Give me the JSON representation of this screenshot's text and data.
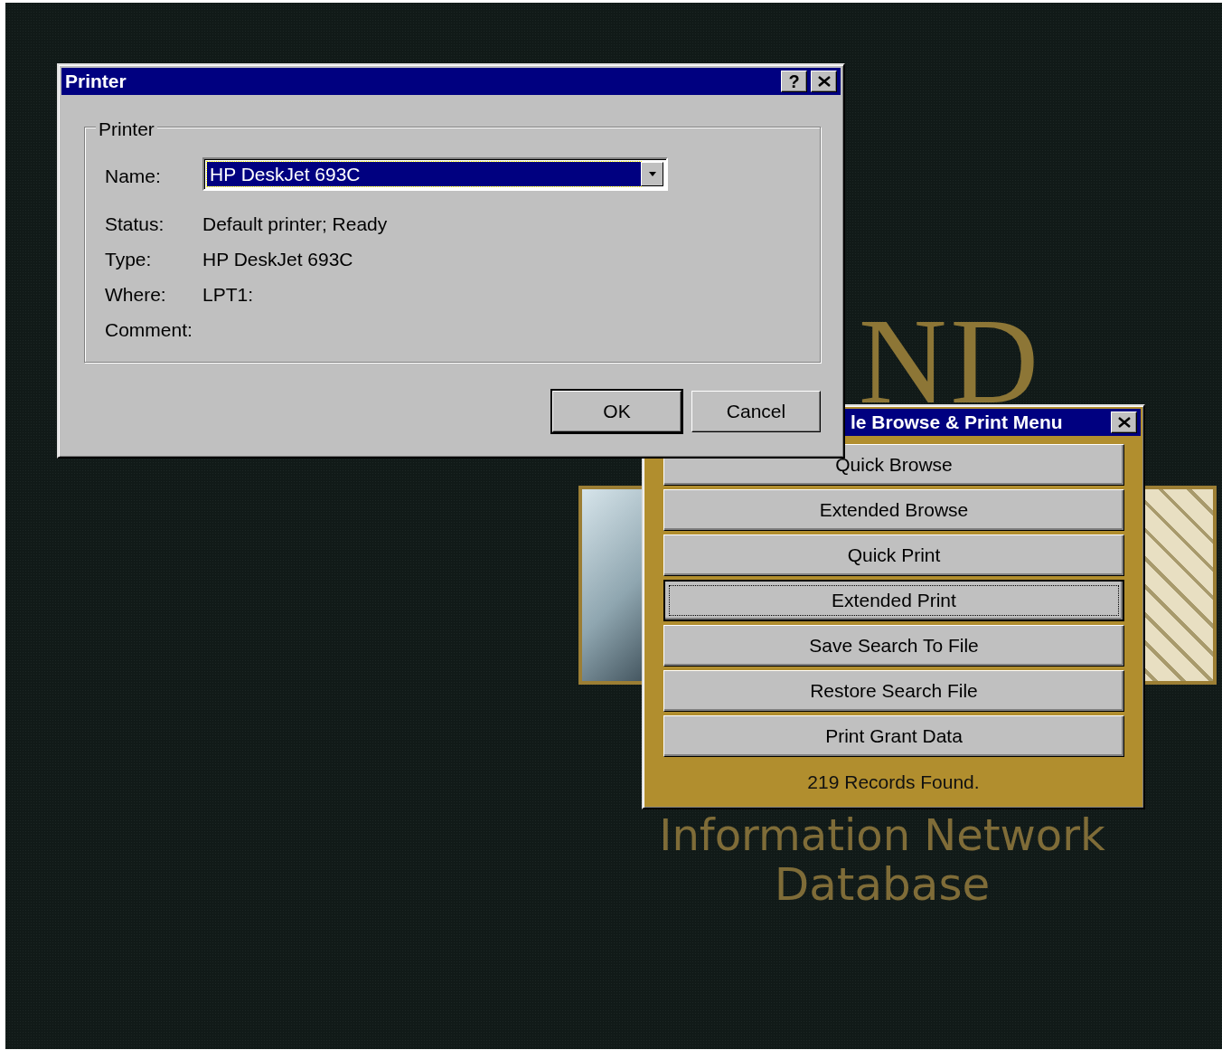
{
  "desktop": {
    "logo_text": "ND",
    "subtitle_lines": [
      "Information Network",
      "Database"
    ]
  },
  "printer_dialog": {
    "title": "Printer",
    "title_buttons": [
      {
        "kind": "help",
        "text": "?"
      },
      {
        "kind": "close"
      }
    ],
    "group_title": "Printer",
    "fields": [
      {
        "kind": "select",
        "label": "Name:",
        "value": "HP DeskJet 693C",
        "highlighted": true
      },
      {
        "kind": "text",
        "label": "Status:",
        "value": "Default printer; Ready"
      },
      {
        "kind": "text",
        "label": "Type:",
        "value": "HP DeskJet 693C"
      },
      {
        "kind": "text",
        "label": "Where:",
        "value": "LPT1:"
      },
      {
        "kind": "text",
        "label": "Comment:"
      }
    ],
    "buttons": [
      {
        "label": "OK",
        "default": true
      },
      {
        "label": "Cancel",
        "default": false
      }
    ]
  },
  "menu_window": {
    "title": "le Browse & Print Menu",
    "buttons": [
      {
        "label": "Quick Browse",
        "focused": false
      },
      {
        "label": "Extended Browse",
        "focused": false
      },
      {
        "label": "Quick Print",
        "focused": false
      },
      {
        "label": "Extended Print",
        "focused": true
      },
      {
        "label": "Save Search To File",
        "focused": false
      },
      {
        "label": "Restore Search File",
        "focused": false
      },
      {
        "label": "Print Grant Data",
        "focused": false
      }
    ],
    "status": "219 Records Found."
  }
}
